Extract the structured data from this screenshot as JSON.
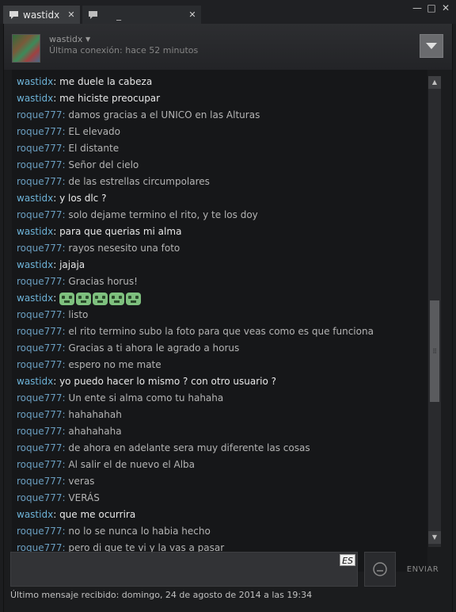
{
  "tabs": [
    {
      "label": "wastidx",
      "close": "✕"
    },
    {
      "label": "_",
      "close": "✕"
    }
  ],
  "window_controls": {
    "minimize": "—",
    "maximize": "□",
    "close": "✕"
  },
  "header": {
    "friend_name": "wastidx",
    "last_seen": "Última conexión: hace 52 minutos"
  },
  "messages": [
    {
      "sender": "wastidx",
      "text": "me duele la cabeza"
    },
    {
      "sender": "wastidx",
      "text": "me hiciste preocupar"
    },
    {
      "sender": "roque777",
      "text": "damos gracias a el UNICO en las Alturas"
    },
    {
      "sender": "roque777",
      "text": "EL elevado"
    },
    {
      "sender": "roque777",
      "text": "El distante"
    },
    {
      "sender": "roque777",
      "text": "Señor del cielo"
    },
    {
      "sender": "roque777",
      "text": "de las estrellas circumpolares"
    },
    {
      "sender": "wastidx",
      "text": "y los dlc ?"
    },
    {
      "sender": "roque777",
      "text": "solo dejame termino el rito, y te los doy"
    },
    {
      "sender": "wastidx",
      "text": "para que querias mi alma"
    },
    {
      "sender": "roque777",
      "text": "rayos nesesito una foto"
    },
    {
      "sender": "wastidx",
      "text": "jajaja"
    },
    {
      "sender": "roque777",
      "text": "Gracias horus!"
    },
    {
      "sender": "wastidx",
      "text": "",
      "emotes": 5
    },
    {
      "sender": "roque777",
      "text": "listo"
    },
    {
      "sender": "roque777",
      "text": "el rito termino subo la foto  para que veas como es que funciona"
    },
    {
      "sender": "roque777",
      "text": "Gracias a ti ahora le agrado a horus"
    },
    {
      "sender": "roque777",
      "text": "espero no me mate"
    },
    {
      "sender": "wastidx",
      "text": "yo puedo hacer lo mismo ? con otro usuario ?"
    },
    {
      "sender": "roque777",
      "text": "Un ente si alma como tu hahaha"
    },
    {
      "sender": "roque777",
      "text": "hahahahah"
    },
    {
      "sender": "roque777",
      "text": "ahahahaha"
    },
    {
      "sender": "roque777",
      "text": "de ahora en adelante sera muy diferente las cosas"
    },
    {
      "sender": "roque777",
      "text": "Al salir el de nuevo el Alba"
    },
    {
      "sender": "roque777",
      "text": "veras"
    },
    {
      "sender": "roque777",
      "text": "VERÁS"
    },
    {
      "sender": "wastidx",
      "text": "que me ocurrira"
    },
    {
      "sender": "roque777",
      "text": "no lo se nunca lo habia hecho"
    },
    {
      "sender": "roque777",
      "text": "pero di que te vi y la vas a pasar"
    }
  ],
  "colon": ":",
  "input": {
    "language_badge": "ES",
    "value": ""
  },
  "send_label": "ENVIAR",
  "status": "Último mensaje recibido: domingo, 24 de agosto de 2014 a las 19:34",
  "colors": {
    "self_name": "#6db3d8",
    "friend_name": "#6a9ec0",
    "background": "#1c1d1f"
  },
  "scrollbar": {
    "position_fraction": 0.62
  }
}
